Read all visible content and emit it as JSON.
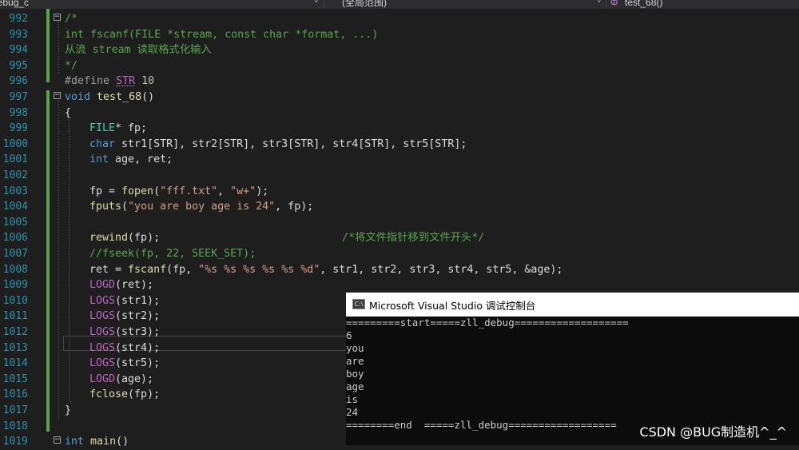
{
  "navbar": {
    "project_combo": "debug_c",
    "scope_combo": "(全局范围)",
    "member_combo": "test_68()"
  },
  "code_lines": [
    {
      "n": "992"
    },
    {
      "n": "993"
    },
    {
      "n": "994"
    },
    {
      "n": "995"
    },
    {
      "n": "996"
    },
    {
      "n": "997"
    },
    {
      "n": "998"
    },
    {
      "n": "999"
    },
    {
      "n": "1000"
    },
    {
      "n": "1001"
    },
    {
      "n": "1002"
    },
    {
      "n": "1003"
    },
    {
      "n": "1004"
    },
    {
      "n": "1005"
    },
    {
      "n": "1006"
    },
    {
      "n": "1007"
    },
    {
      "n": "1008"
    },
    {
      "n": "1009"
    },
    {
      "n": "1010"
    },
    {
      "n": "1011"
    },
    {
      "n": "1012"
    },
    {
      "n": "1013"
    },
    {
      "n": "1014"
    },
    {
      "n": "1015"
    },
    {
      "n": "1016"
    },
    {
      "n": "1017"
    },
    {
      "n": "1018"
    },
    {
      "n": "1019"
    }
  ],
  "code": {
    "l992": "/*",
    "l993": "int fscanf(FILE *stream, const char *format, ...)",
    "l994": "从流 stream 读取格式化输入",
    "l995": "*/",
    "l996_kw": "#define",
    "l996_name": "STR",
    "l996_val": "10",
    "l997_kw": "void",
    "l997_fn": "test_68",
    "l997_rest": "()",
    "l998": "{",
    "l999_ty": "FILE",
    "l999_rest": "* fp;",
    "l1000_kw": "char",
    "l1000_rest": "str1[STR], str2[STR], str3[STR], str4[STR], str5[STR];",
    "l1001_kw": "int",
    "l1001_rest": "age, ret;",
    "l1003_a": "fp = ",
    "l1003_fn": "fopen",
    "l1003_b": "(",
    "l1003_s1": "\"fff.txt\"",
    "l1003_c": ", ",
    "l1003_s2": "\"w+\"",
    "l1003_d": ");",
    "l1004_fn": "fputs",
    "l1004_a": "(",
    "l1004_s": "\"you are boy age is 24\"",
    "l1004_b": ", fp);",
    "l1006_fn": "rewind",
    "l1006_a": "(fp);",
    "l1006_cm": "/*将文件指针移到文件开头*/",
    "l1007": "//fseek(fp, 22, SEEK_SET);",
    "l1008_a": "ret = ",
    "l1008_fn": "fscanf",
    "l1008_b": "(fp, ",
    "l1008_s": "\"%s %s %s %s %s %d\"",
    "l1008_c": ", str1, str2, str3, str4, str5, &age);",
    "l1009_mc": "LOGD",
    "l1009_rest": "(ret);",
    "l1010_mc": "LOGS",
    "l1010_rest": "(str1);",
    "l1011_mc": "LOGS",
    "l1011_rest": "(str2);",
    "l1012_mc": "LOGS",
    "l1012_rest": "(str3);",
    "l1013_mc": "LOGS",
    "l1013_rest": "(str4);",
    "l1014_mc": "LOGS",
    "l1014_rest": "(str5);",
    "l1015_mc": "LOGD",
    "l1015_rest": "(age);",
    "l1016_fn": "fclose",
    "l1016_rest": "(fp);",
    "l1017": "}",
    "l1019_kw": "int",
    "l1019_fn": "main",
    "l1019_rest": "()"
  },
  "console": {
    "title": "Microsoft Visual Studio 调试控制台",
    "icon_label": "C:\\",
    "lines": [
      "=========start=====zll_debug===================",
      "6",
      "you",
      "are",
      "boy",
      "age",
      "is",
      "24",
      "========end  =====zll_debug=================="
    ]
  },
  "watermark": "CSDN @BUG制造机^_^"
}
